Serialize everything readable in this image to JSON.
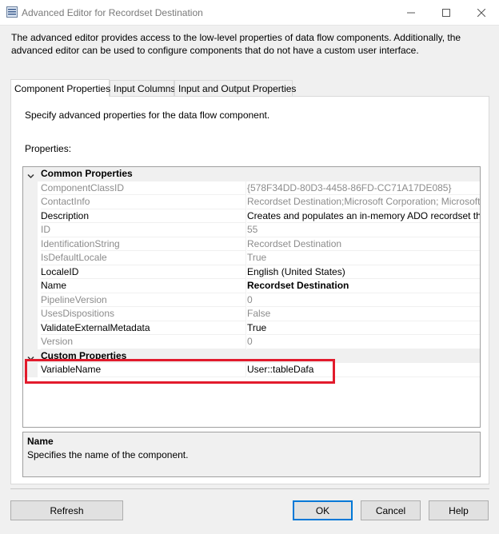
{
  "window": {
    "title": "Advanced Editor for Recordset Destination"
  },
  "description": "The advanced editor provides access to the low-level properties of data flow components. Additionally, the advanced editor can be used to configure components that do not have a custom user interface.",
  "tabs": [
    {
      "label": "Component Properties",
      "active": true
    },
    {
      "label": "Input Columns",
      "active": false
    },
    {
      "label": "Input and Output Properties",
      "active": false
    }
  ],
  "panel": {
    "hint": "Specify advanced properties for the data flow component.",
    "properties_label": "Properties:"
  },
  "grid": {
    "common_category": "Common Properties",
    "custom_category": "Custom Properties",
    "common_rows": [
      {
        "name": "ComponentClassID",
        "value": "{578F34DD-80D3-4458-86FD-CC71A17DE085}",
        "disabled": true
      },
      {
        "name": "ContactInfo",
        "value": "Recordset Destination;Microsoft Corporation; Microsoft SQ",
        "disabled": true
      },
      {
        "name": "Description",
        "value": "Creates and populates an in-memory ADO recordset that i",
        "disabled": false
      },
      {
        "name": "ID",
        "value": "55",
        "disabled": true
      },
      {
        "name": "IdentificationString",
        "value": "Recordset Destination",
        "disabled": true
      },
      {
        "name": "IsDefaultLocale",
        "value": "True",
        "disabled": true
      },
      {
        "name": "LocaleID",
        "value": "English (United States)",
        "disabled": false
      },
      {
        "name": "Name",
        "value": "Recordset Destination",
        "disabled": false,
        "bold": true
      },
      {
        "name": "PipelineVersion",
        "value": "0",
        "disabled": true
      },
      {
        "name": "UsesDispositions",
        "value": "False",
        "disabled": true
      },
      {
        "name": "ValidateExternalMetadata",
        "value": "True",
        "disabled": false
      },
      {
        "name": "Version",
        "value": "0",
        "disabled": true
      }
    ],
    "custom_rows": [
      {
        "name": "VariableName",
        "value": "User::tableDafa",
        "disabled": false
      }
    ]
  },
  "help": {
    "title": "Name",
    "text": "Specifies the name of the component."
  },
  "buttons": {
    "refresh": "Refresh",
    "ok": "OK",
    "cancel": "Cancel",
    "help": "Help"
  },
  "colors": {
    "highlight": "#e21b2c",
    "default_button_border": "#0078d7"
  }
}
